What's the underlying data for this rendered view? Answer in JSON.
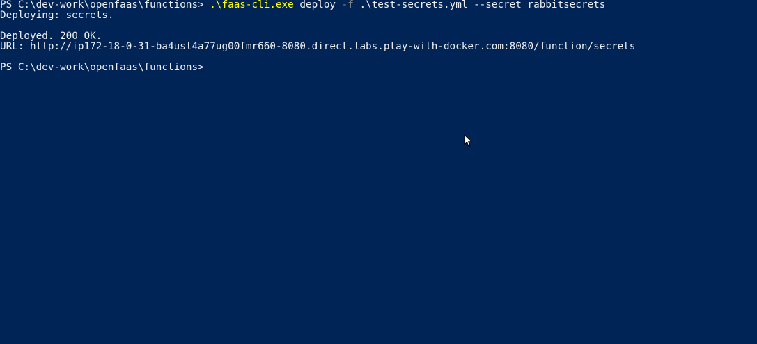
{
  "terminal": {
    "background": "#012456",
    "foreground": "#eeedf0",
    "exe_color": "#ffff00",
    "flag_color": "#808080",
    "line1": {
      "prompt": "PS C:\\dev-work\\openfaas\\functions> ",
      "exe": ".\\faas-cli.exe",
      "arg1": " deploy ",
      "flag": "-f",
      "rest": " .\\test-secrets.yml --secret rabbitsecrets"
    },
    "line2": "Deploying: secrets.",
    "line4": "Deployed. 200 OK.",
    "line5": "URL: http://ip172-18-0-31-ba4usl4a77ug00fmr660-8080.direct.labs.play-with-docker.com:8080/function/secrets",
    "line7": "PS C:\\dev-work\\openfaas\\functions>"
  },
  "pointer": {
    "icon": "mouse-pointer-icon"
  }
}
